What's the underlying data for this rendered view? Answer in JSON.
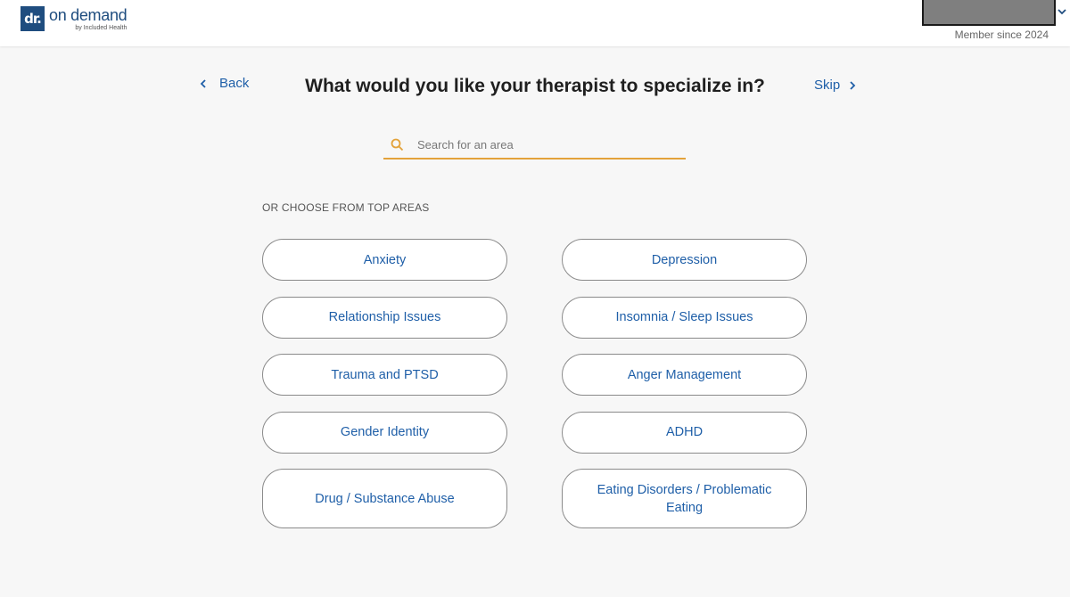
{
  "header": {
    "logo_mark": "dr.",
    "logo_text": "on demand",
    "logo_subtext": "by Included Health",
    "member_since": "Member since 2024"
  },
  "nav": {
    "back_label": "Back",
    "skip_label": "Skip"
  },
  "main": {
    "title": "What would you like your therapist to specialize in?",
    "search": {
      "placeholder": "Search for an area",
      "value": ""
    },
    "section_label": "OR CHOOSE FROM TOP AREAS",
    "areas": [
      "Anxiety",
      "Depression",
      "Relationship Issues",
      "Insomnia / Sleep Issues",
      "Trauma and PTSD",
      "Anger Management",
      "Gender Identity",
      "ADHD",
      "Drug / Substance Abuse",
      "Eating Disorders / Problematic Eating"
    ]
  },
  "colors": {
    "brand": "#1f4d7f",
    "link": "#1f5fa8",
    "search_accent": "#e3a23a",
    "background": "#f7f7f7"
  },
  "icons": {
    "back": "chevron-left-icon",
    "skip": "chevron-right-icon",
    "search": "search-icon",
    "account_menu": "chevron-down-icon"
  }
}
